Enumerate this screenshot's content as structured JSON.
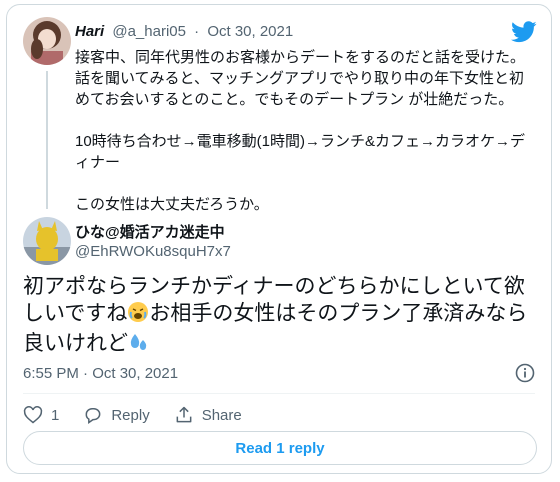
{
  "colors": {
    "accent": "#1d9bf0",
    "muted": "#536471",
    "border": "#cfd9de",
    "text": "#0f1419"
  },
  "parent": {
    "name": "Hari",
    "handle": "@a_hari05",
    "separator": "·",
    "date": "Oct 30, 2021",
    "lines": [
      "接客中、同年代男性のお客様からデートをするのだと話を受けた。",
      "話を聞いてみると、マッチングアプリでやり取り中の年下女性と初めてお会いするとのこと。でもそのデートプラン が壮絶だった。",
      "10時待ち合わせ→電車移動(1時間)→ランチ&カフェ→カラオケ→ディナー",
      "この女性は大丈夫だろうか。"
    ]
  },
  "reply": {
    "name": "ひな@婚活アカ迷走中",
    "handle": "@EhRWOKu8squH7x7",
    "text_part1": "初アポならランチかディナーのどちらかにしといて欲しいですね",
    "text_part2": "お相手の女性はそのプラン了承済みなら良いけれど",
    "emoji1": "weary-face-emoji",
    "emoji2": "sweat-droplets-emoji",
    "timestamp": "6:55 PM · Oct 30, 2021"
  },
  "actions": {
    "like_count": "1",
    "reply_label": "Reply",
    "share_label": "Share",
    "read_replies_label": "Read 1 reply"
  },
  "icons": {
    "brand": "twitter-bird-icon",
    "info": "info-icon",
    "like": "heart-icon",
    "reply": "reply-bubble-icon",
    "share": "share-icon"
  }
}
